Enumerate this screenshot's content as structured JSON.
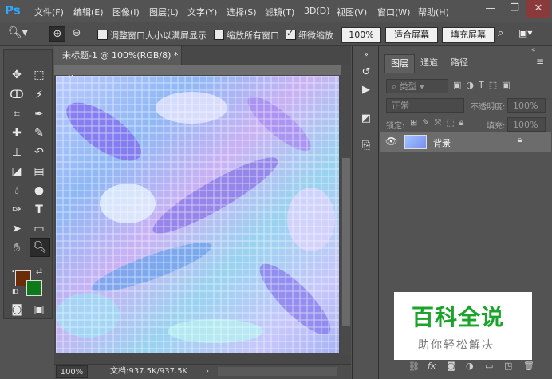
{
  "app": {
    "logo": "Ps"
  },
  "menu": [
    "文件(F)",
    "编辑(E)",
    "图像(I)",
    "图层(L)",
    "文字(Y)",
    "选择(S)",
    "滤镜(T)",
    "3D(D)",
    "视图(V)",
    "窗口(W)",
    "帮助(H)"
  ],
  "window_controls": {
    "minimize": "—",
    "restore": "❐",
    "close": "✕"
  },
  "options": {
    "resize_window": "调整窗口大小以满屏显示",
    "zoom_all": "缩放所有窗口",
    "scrubby_zoom": "细微缩放",
    "zoom_value": "100%",
    "fit_screen": "适合屏幕",
    "fill_screen": "填充屏幕",
    "checks": {
      "resize_window": false,
      "zoom_all": false,
      "scrubby_zoom": true
    }
  },
  "document": {
    "tab_title": "未标题-1 @ 100%(RGB/8) *",
    "tab_close": "×",
    "zoom": "100%",
    "doc_info": "文档:937.5K/937.5K"
  },
  "panel": {
    "tabs": [
      "图层",
      "通道",
      "路径"
    ],
    "filter_kind": "类型",
    "blend_mode": "正常",
    "opacity_label": "不透明度:",
    "opacity_value": "100%",
    "lock_label": "锁定:",
    "fill_label": "填充:",
    "fill_value": "100%",
    "layer_name": "背景"
  },
  "watermark": {
    "title": "百科全说",
    "subtitle": "助你轻松解决"
  },
  "colors": {
    "foreground": "#6b2c0a",
    "background": "#0f7a1c",
    "accent": "#31a8ff",
    "watermark_green": "#1aa52a"
  }
}
